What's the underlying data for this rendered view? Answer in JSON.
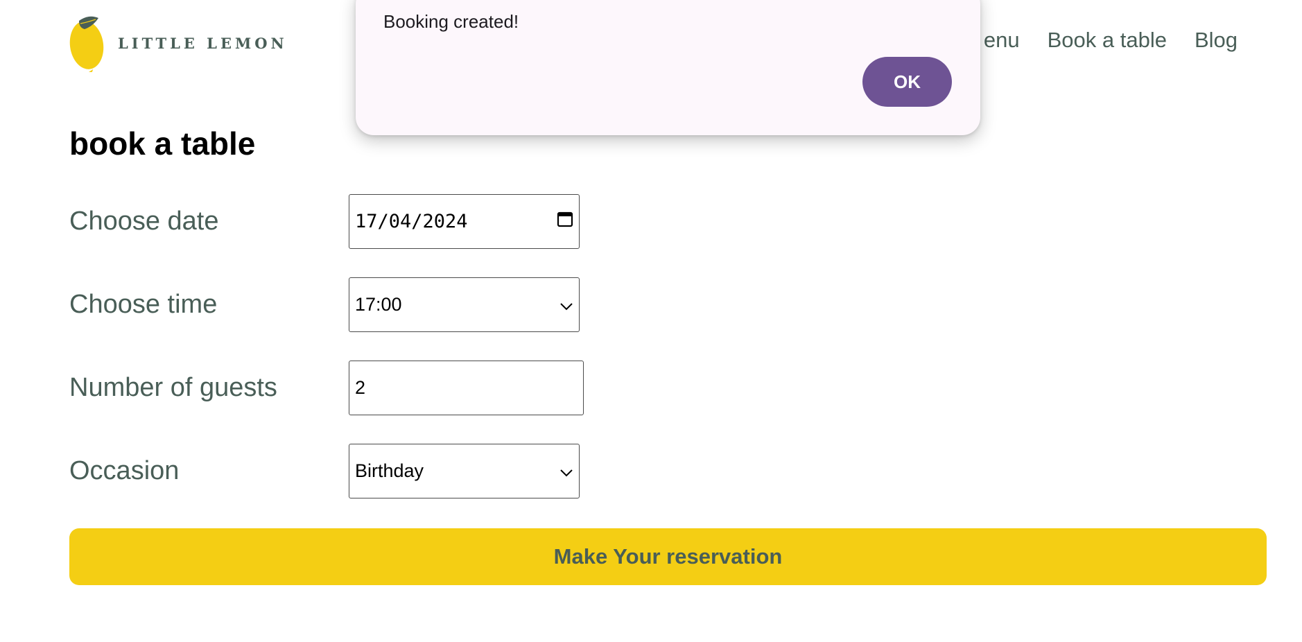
{
  "header": {
    "logo_text": "LITTLE LEMON",
    "nav": {
      "menu_visible_fragment": "enu",
      "book": "Book a table",
      "blog": "Blog"
    }
  },
  "page_title": "book a table",
  "form": {
    "date_label": "Choose date",
    "date_value": "17/04/2024",
    "time_label": "Choose time",
    "time_value": "17:00",
    "guests_label": "Number of guests",
    "guests_value": "2",
    "occasion_label": "Occasion",
    "occasion_value": "Birthday",
    "submit_label": "Make Your reservation"
  },
  "dialog": {
    "message": "Booking created!",
    "ok_label": "OK"
  },
  "icons": {
    "logo": "lemon-icon",
    "date": "calendar-icon",
    "dropdown": "chevron-down-icon"
  },
  "colors": {
    "brand_green": "#495e57",
    "brand_yellow": "#f4ce14",
    "dialog_button": "#6e5394",
    "dialog_background": "#fdf7fc"
  }
}
